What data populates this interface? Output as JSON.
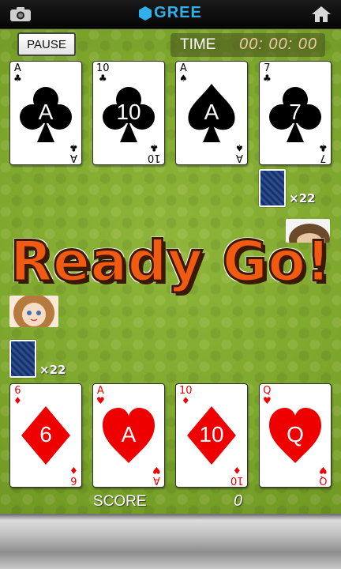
{
  "header": {
    "brand": "GREE"
  },
  "controls": {
    "pause_label": "PAUSE"
  },
  "timer": {
    "label": "TIME",
    "value": "00: 00: 00"
  },
  "banner": {
    "text": "Ready Go!"
  },
  "opponent": {
    "cards": [
      {
        "rank": "A",
        "suit": "♣",
        "color": "black"
      },
      {
        "rank": "10",
        "suit": "♣",
        "color": "black"
      },
      {
        "rank": "A",
        "suit": "♠",
        "color": "black"
      },
      {
        "rank": "7",
        "suit": "♣",
        "color": "black"
      }
    ],
    "deck_count": "×22"
  },
  "player": {
    "cards": [
      {
        "rank": "6",
        "suit": "♦",
        "color": "red"
      },
      {
        "rank": "A",
        "suit": "♥",
        "color": "red"
      },
      {
        "rank": "10",
        "suit": "♦",
        "color": "red"
      },
      {
        "rank": "Q",
        "suit": "♥",
        "color": "red"
      }
    ],
    "deck_count": "×22"
  },
  "score": {
    "label": "SCORE",
    "value": "0"
  },
  "colors": {
    "table_green": "#7fa82e",
    "brand_blue": "#2fb0ea",
    "banner_orange": "#f25a12",
    "red_suit": "#ee0000"
  }
}
